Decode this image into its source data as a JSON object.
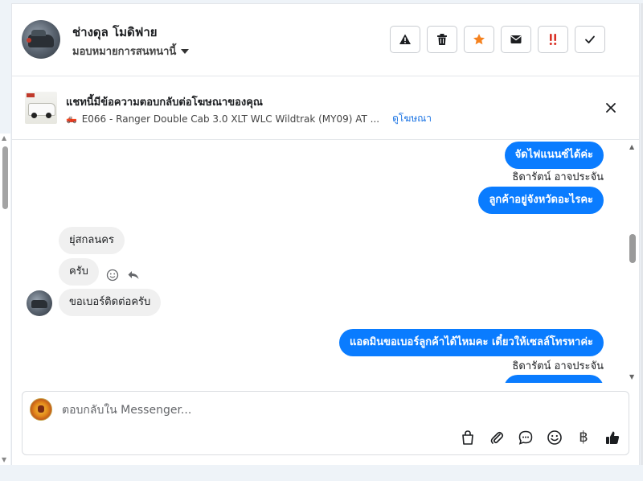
{
  "contact": {
    "name": "ช่างดุล โมดิฟาย",
    "assign_label": "มอบหมายการสนทนานี้"
  },
  "actions": [
    {
      "name": "report-spam",
      "icon": "warning-icon"
    },
    {
      "name": "delete",
      "icon": "trash-icon"
    },
    {
      "name": "star",
      "icon": "star-icon"
    },
    {
      "name": "mark-unread",
      "icon": "envelope-icon"
    },
    {
      "name": "important",
      "icon": "double-exclamation-icon"
    },
    {
      "name": "mark-done",
      "icon": "checkmark-icon"
    }
  ],
  "ad": {
    "title": "แชทนี้มีข้อความตอบกลับต่อโฆษณาของคุณ",
    "subtitle": "E066 - Ranger Double Cab 3.0 XLT WLC Wildtrak (MY09) AT ...",
    "link": "ดูโฆษณา"
  },
  "messages": {
    "m1": "จัดไฟแนนซ์ได้ค่ะ",
    "sender1": "ธิดารัตน์ อาจประจัน",
    "m2": "ลูกค้าอยู่จังหวัดอะไรคะ",
    "m3": "ยุ่สกลนคร",
    "m4": "ครับ",
    "m5": "ขอเบอร์ติดต่อครับ",
    "m6": "แอดมินขอเบอร์ลูกค้าได้ไหมคะ เดี๋ยวให้เซลล์โทรหาค่ะ",
    "sender2": "ธิดารัตน์ อาจประจัน"
  },
  "composer": {
    "placeholder": "ตอบกลับใน Messenger...",
    "baht_symbol": "฿"
  },
  "colors": {
    "outgoing": "#0a7cff",
    "incoming": "#f0f0f0",
    "link": "#1b74e4",
    "star": "#f5821f",
    "important": "#d93025"
  }
}
